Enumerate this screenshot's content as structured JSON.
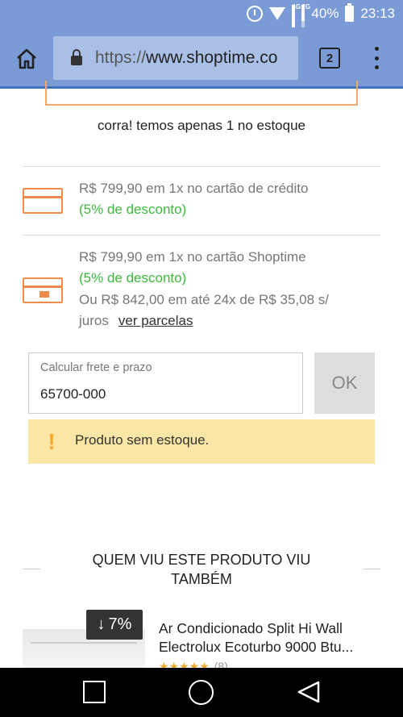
{
  "status_bar": {
    "network_1": "4G",
    "network_2": "2G",
    "battery": "40%",
    "time": "23:13",
    "icons": [
      "alarm-icon",
      "wifi-icon",
      "signal-icon",
      "signal-icon",
      "battery-icon"
    ]
  },
  "browser": {
    "url_protocol": "https://",
    "url_host": "www.shoptime.co",
    "tab_count": "2"
  },
  "product": {
    "stock_text": "corra! temos apenas 1 no estoque",
    "payment_options": [
      {
        "line1": "R$ 799,90 em 1x no cartão de crédito",
        "discount": "(5% de desconto)"
      },
      {
        "line1": "R$ 799,90 em 1x no cartão Shoptime",
        "discount": "(5% de desconto)",
        "installments_1": "Ou R$ 842,00 em até 24x de R$ 35,08 s/",
        "installments_2": "juros",
        "link": "ver parcelas"
      }
    ]
  },
  "freight": {
    "label": "Calcular frete e prazo",
    "value": "65700-000",
    "ok_label": "OK"
  },
  "alert": {
    "icon": "!",
    "text": "Produto sem estoque."
  },
  "recommendations": {
    "title_line1": "QUEM VIU ESTE PRODUTO VIU",
    "title_line2": "TAMBÉM",
    "items": [
      {
        "discount_badge": "7%",
        "title_line1": "Ar Condicionado Split Hi Wall",
        "title_line2": "Electrolux Ecoturbo 9000 Btu...",
        "stars": "★★★★★",
        "rating_count": "(8)"
      }
    ]
  },
  "colors": {
    "browser_bar": "#7b9bd6",
    "accent_orange": "#f08c4b",
    "discount_green": "#3cb93c",
    "alert_bg": "#fbe6a6"
  }
}
